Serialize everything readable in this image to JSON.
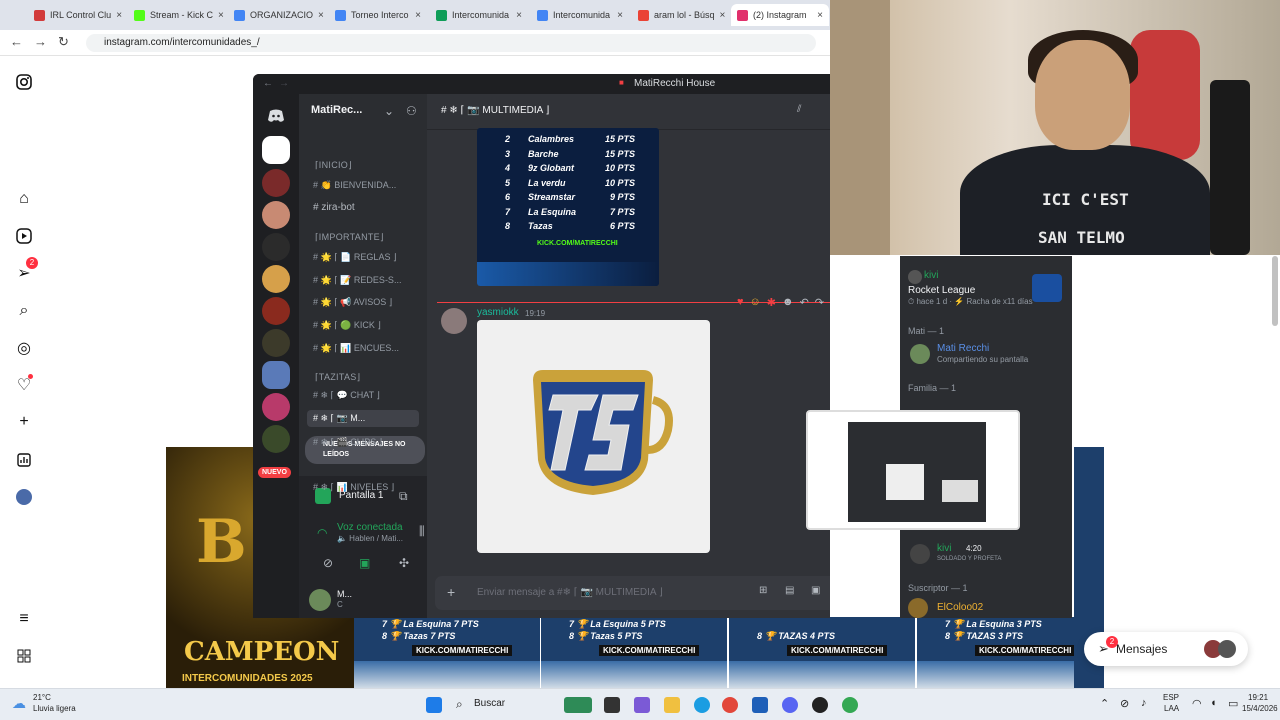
{
  "tabs": [
    {
      "label": "IRL Control Clu",
      "color": "#d23b3b",
      "active": false
    },
    {
      "label": "Stream - Kick C",
      "color": "#53fc18",
      "active": false
    },
    {
      "label": "ORGANIZACIO",
      "color": "#4285f4",
      "active": false
    },
    {
      "label": "Torneo Interco",
      "color": "#4285f4",
      "active": false
    },
    {
      "label": "Intercomunida",
      "color": "#0f9d58",
      "active": false
    },
    {
      "label": "Intercomunida",
      "color": "#4285f4",
      "active": false
    },
    {
      "label": "aram lol - Búsq",
      "color": "#ea4335",
      "active": false
    },
    {
      "label": "(2) Instagram",
      "color": "#e1306c",
      "active": true
    }
  ],
  "url": "instagram.com/intercomunidades_/",
  "instagram": {
    "notif_badge": "2"
  },
  "discord": {
    "window_title": "MatiRecchi House",
    "server_name": "MatiRec...",
    "channel_header": "# ❄ ⌈ 📷 MULTIMEDIA ⌋",
    "categories": [
      "⌈INICIO⌋",
      "⌈IMPORTANTE⌋",
      "⌈TAZITAS⌋"
    ],
    "channels": [
      "# 👏 BIENVENIDA...",
      "# zira-bot",
      "# 🌟 ⌈ 📄 REGLAS ⌋",
      "# 🌟 ⌈ 📝 REDES-S...",
      "# 🌟 ⌈ 📢 AVISOS ⌋",
      "# 🌟 ⌈ 🟢 KICK ⌋",
      "# 🌟 ⌈ 📊 ENCUES...",
      "# ❄ ⌈ 💬 CHAT ⌋",
      "# ❄ ⌈ 📷 M...",
      "# ❄ ⌈ 🎬 CLIPS ⌋",
      "# ❄ ⌈ 📊 NIVELES ⌋"
    ],
    "new_badge": "NUEVO",
    "new_messages": "NUEVOS MENSAJES NO LEÍDOS",
    "screen_share": "Pantalla 1",
    "voice_status": "Voz conectada",
    "voice_channel": "🔈 Hablen / Mati...",
    "user_short": "M...",
    "user_status": "C",
    "leaderboard": [
      {
        "pos": "2",
        "team": "Calambres",
        "pts": "15 PTS"
      },
      {
        "pos": "3",
        "team": "Barche",
        "pts": "15 PTS"
      },
      {
        "pos": "4",
        "team": "9z Globant",
        "pts": "10 PTS"
      },
      {
        "pos": "5",
        "team": "La verdu",
        "pts": "10 PTS"
      },
      {
        "pos": "6",
        "team": "Streamstar",
        "pts": "9 PTS"
      },
      {
        "pos": "7",
        "team": "La Esquina",
        "pts": "7 PTS"
      },
      {
        "pos": "8",
        "team": "Tazas",
        "pts": "6 PTS"
      }
    ],
    "kick_url": "KICK.COM/MATIRECCHI",
    "msg_author": "yasmiokk",
    "msg_time": "19:19",
    "input_placeholder": "Enviar mensaje a #❄ ⌈ 📷 MULTIMEDIA ⌋"
  },
  "members": {
    "activity_user": "kivi",
    "activity_game": "Rocket League",
    "activity_meta": "⏱ hace 1 d · ⚡ Racha de x11 días",
    "group1": "Mati — 1",
    "member1": "Mati Recchi",
    "member1_status": "Compartiendo su pantalla",
    "group2": "Familia — 1",
    "member2": "kivi",
    "member2_level": "4:20",
    "member2_status": "SOLDADO Y PROFETA",
    "group3": "Suscriptor — 1",
    "member3": "ElColoo02"
  },
  "feed": {
    "campeon": "CAMPEON",
    "campeon_sub": "INTERCOMUNIDADES 2025",
    "posts": [
      {
        "r7": "7  🏆 La Esquina   7 PTS",
        "r8": "8  🏆 Tazas   7 PTS"
      },
      {
        "r7": "7  🏆 La Esquina   5 PTS",
        "r8": "8  🏆 Tazas   5 PTS"
      },
      {
        "r7": "",
        "r8": "8  🏆 TAZAS   4 PTS"
      },
      {
        "r7": "7  🏆 La Esquina   3 PTS",
        "r8": "8  🏆 TAZAS   3 PTS"
      }
    ],
    "messages_label": "Mensajes",
    "messages_badge": "2"
  },
  "webcam": {
    "shirt_text1": "ICI C'EST",
    "shirt_text2": "SAN TELMO"
  },
  "taskbar": {
    "weather_temp": "21°C",
    "weather_desc": "Lluvia ligera",
    "search": "Buscar",
    "lang1": "ESP",
    "lang2": "LAA",
    "time": "19:21",
    "date": "15/4/2026"
  }
}
